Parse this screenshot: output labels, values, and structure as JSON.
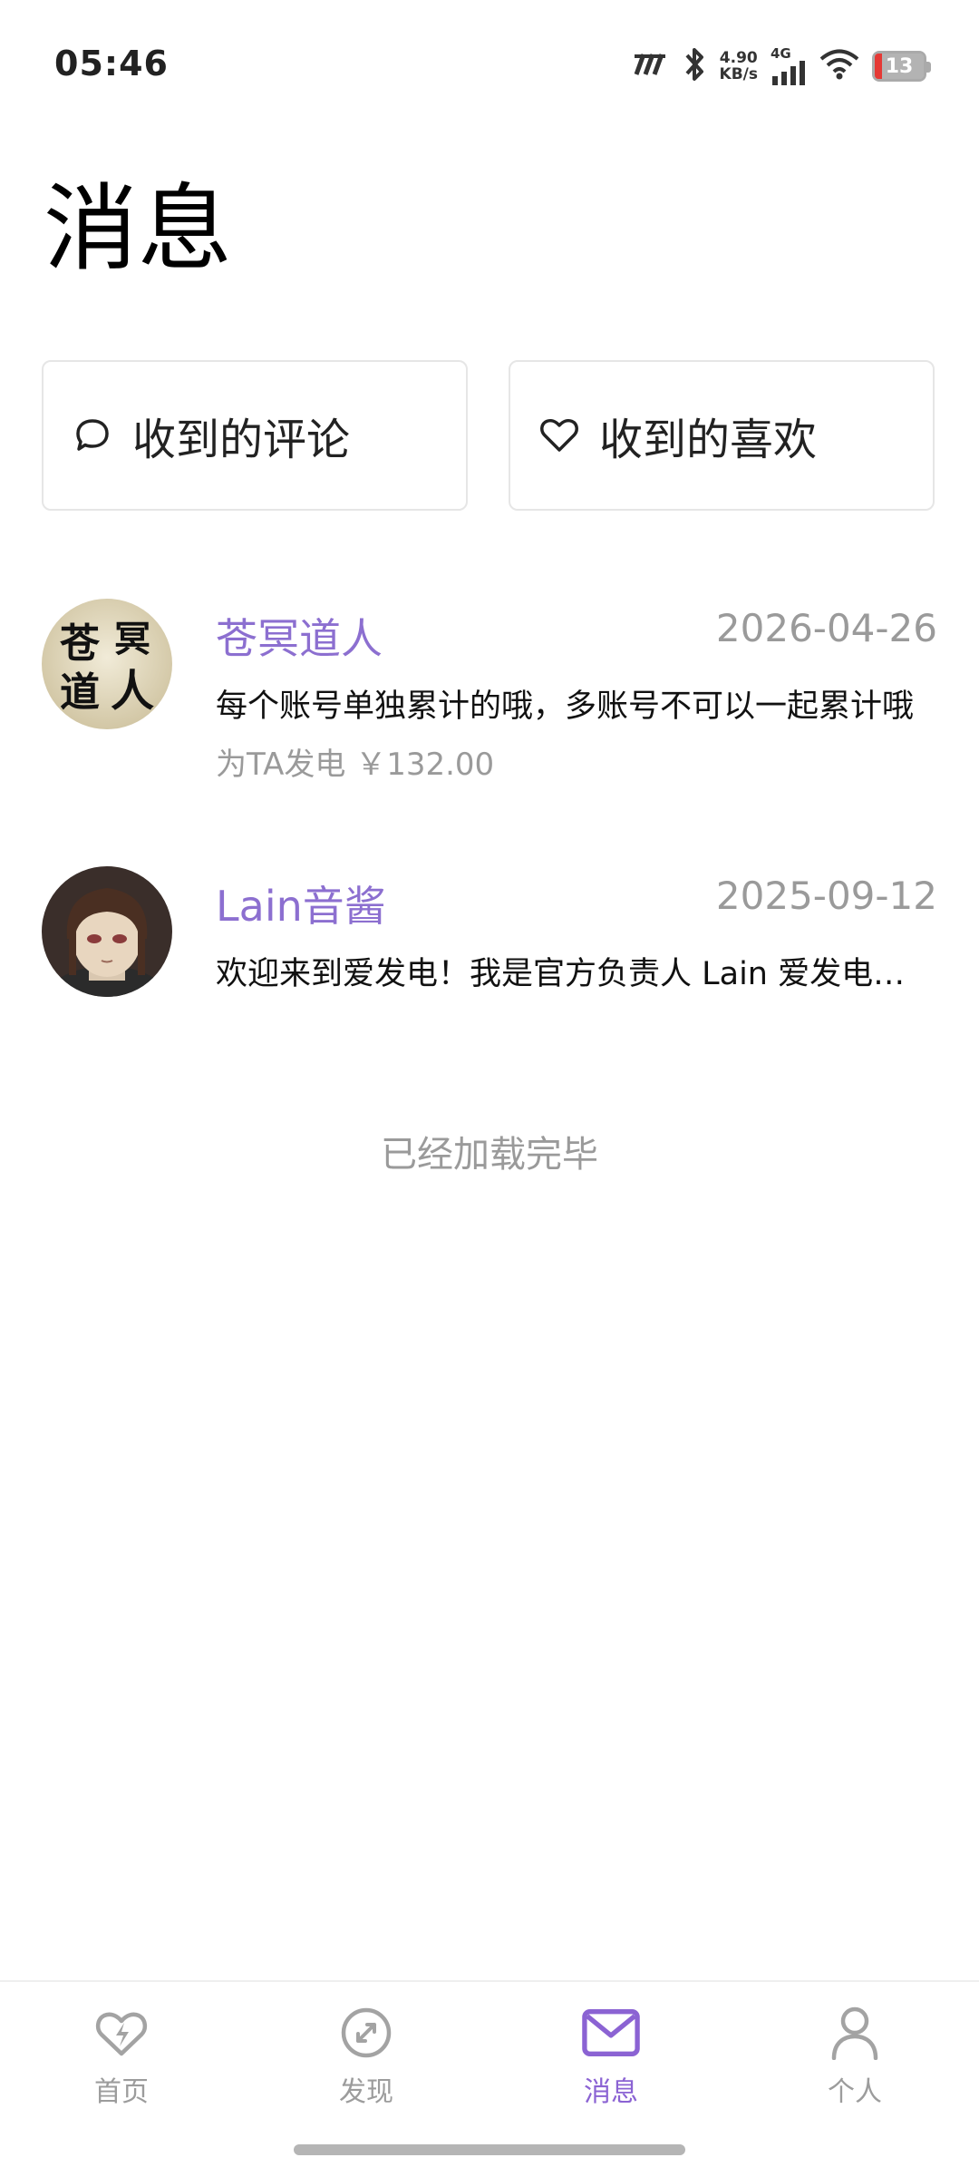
{
  "status_bar": {
    "time": "05:46",
    "net_speed_value": "4.90",
    "net_speed_unit": "KB/s",
    "network_type": "4G",
    "battery_level": "13",
    "icons": [
      "hd-icon",
      "bluetooth-icon",
      "signal-icon",
      "wifi-icon",
      "battery-icon"
    ]
  },
  "page": {
    "title": "消息"
  },
  "cards": {
    "comments_label": "收到的评论",
    "likes_label": "收到的喜欢"
  },
  "messages": [
    {
      "name": "苍冥道人",
      "date": "2026-04-26",
      "text": "每个账号单独累计的哦，多账号不可以一起累计哦",
      "sub": "为TA发电 ￥132.00",
      "avatar_chars": [
        "苍",
        "冥",
        "道",
        "人"
      ]
    },
    {
      "name": "Lain音酱",
      "date": "2025-09-12",
      "text": "欢迎来到爱发电！我是官方负责人 Lain 爱发电…"
    }
  ],
  "list_footer": "已经加载完毕",
  "nav": {
    "items": [
      {
        "label": "首页",
        "icon": "heart-bolt-icon"
      },
      {
        "label": "发现",
        "icon": "compass-icon"
      },
      {
        "label": "消息",
        "icon": "mail-icon"
      },
      {
        "label": "个人",
        "icon": "person-icon"
      }
    ],
    "active_color": "#8b63d3",
    "inactive_color": "#9c9c9c"
  },
  "colors": {
    "accent": "#8c6fd0",
    "muted_text": "#9a9a9a"
  }
}
